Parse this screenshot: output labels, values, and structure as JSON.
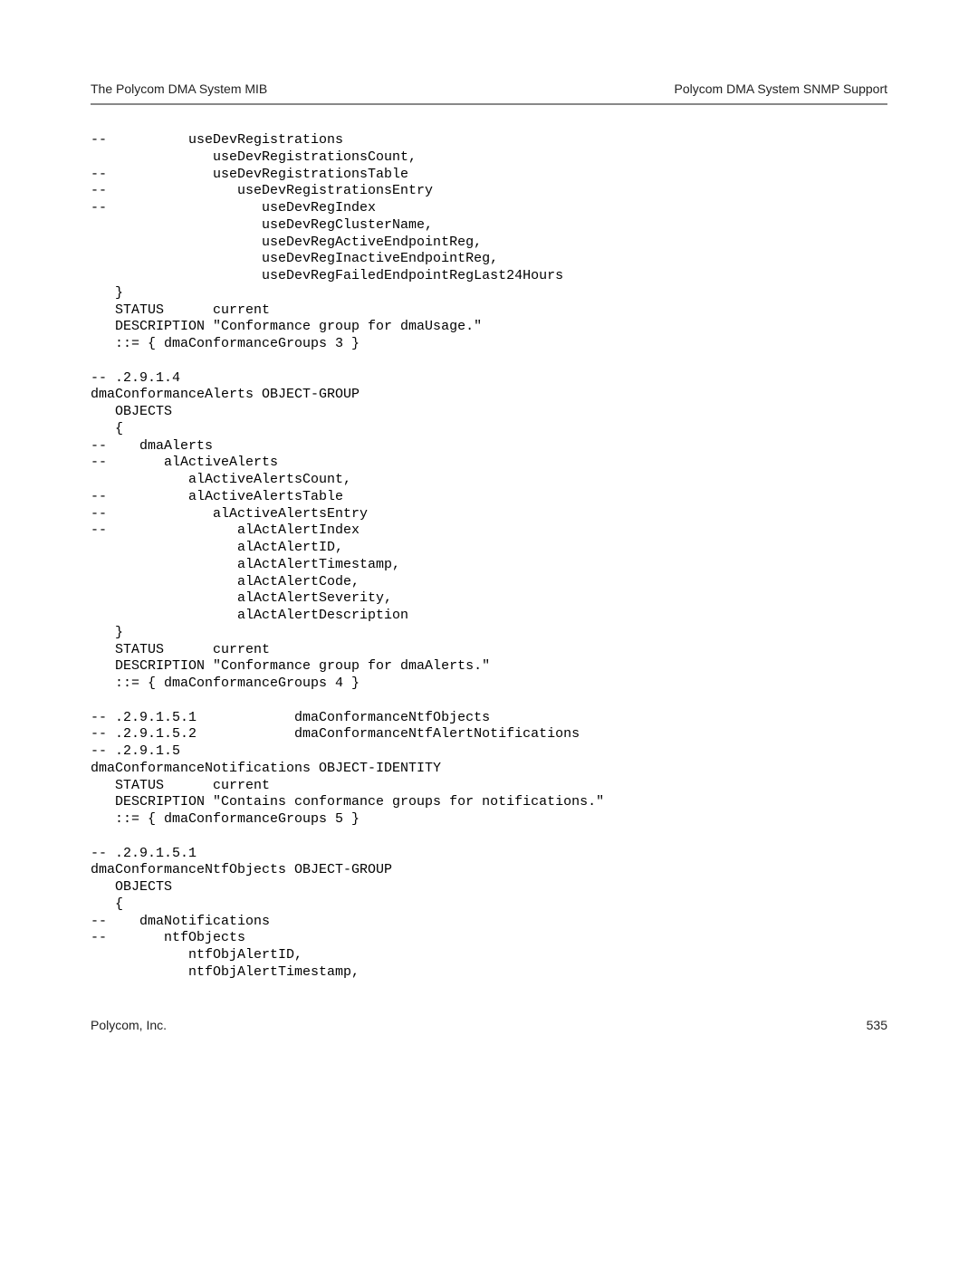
{
  "header": {
    "left": "The Polycom DMA System MIB",
    "right": "Polycom DMA System SNMP Support"
  },
  "code": "--          useDevRegistrations\n               useDevRegistrationsCount,\n--             useDevRegistrationsTable\n--                useDevRegistrationsEntry\n--                   useDevRegIndex\n                     useDevRegClusterName,\n                     useDevRegActiveEndpointReg,\n                     useDevRegInactiveEndpointReg,\n                     useDevRegFailedEndpointRegLast24Hours\n   }\n   STATUS      current\n   DESCRIPTION \"Conformance group for dmaUsage.\"\n   ::= { dmaConformanceGroups 3 }\n\n-- .2.9.1.4\ndmaConformanceAlerts OBJECT-GROUP\n   OBJECTS\n   {\n--    dmaAlerts\n--       alActiveAlerts\n            alActiveAlertsCount,\n--          alActiveAlertsTable\n--             alActiveAlertsEntry\n--                alActAlertIndex\n                  alActAlertID,\n                  alActAlertTimestamp,\n                  alActAlertCode,\n                  alActAlertSeverity,\n                  alActAlertDescription\n   }\n   STATUS      current\n   DESCRIPTION \"Conformance group for dmaAlerts.\"\n   ::= { dmaConformanceGroups 4 }\n\n-- .2.9.1.5.1            dmaConformanceNtfObjects\n-- .2.9.1.5.2            dmaConformanceNtfAlertNotifications\n-- .2.9.1.5\ndmaConformanceNotifications OBJECT-IDENTITY\n   STATUS      current\n   DESCRIPTION \"Contains conformance groups for notifications.\"\n   ::= { dmaConformanceGroups 5 }\n\n-- .2.9.1.5.1\ndmaConformanceNtfObjects OBJECT-GROUP\n   OBJECTS\n   {\n--    dmaNotifications\n--       ntfObjects\n            ntfObjAlertID,\n            ntfObjAlertTimestamp,",
  "footer": {
    "left": "Polycom, Inc.",
    "right": "535"
  }
}
